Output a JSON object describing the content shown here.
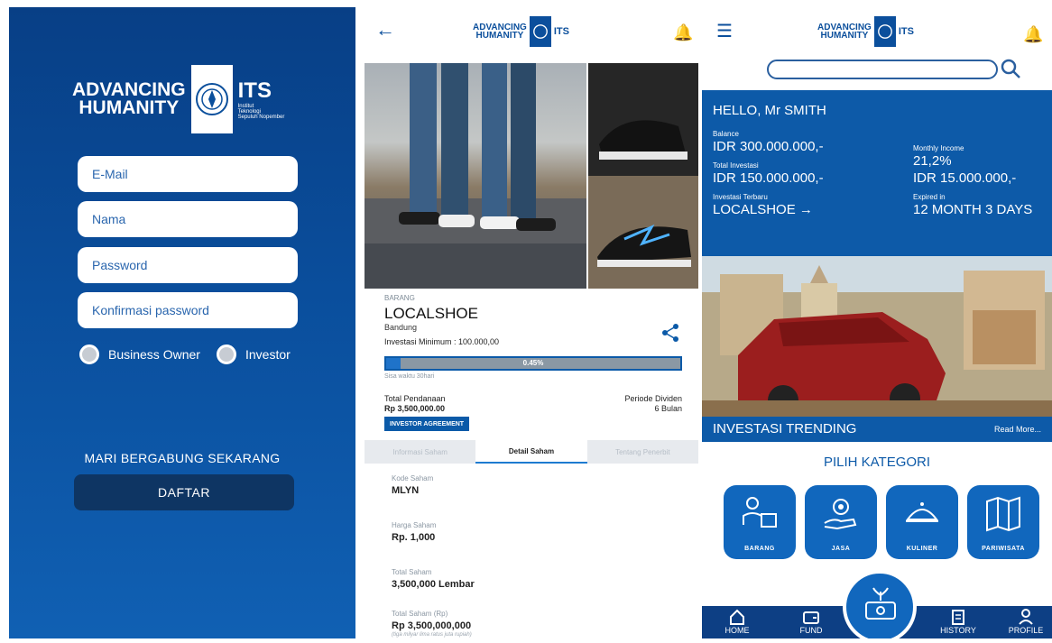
{
  "brand": {
    "line1": "ADVANCING",
    "line2": "HUMANITY",
    "its": "ITS",
    "its_sub1": "Institut",
    "its_sub2": "Teknologi",
    "its_sub3": "Sepuluh Nopember"
  },
  "register": {
    "email_placeholder": "E-Mail",
    "name_placeholder": "Nama",
    "password_placeholder": "Password",
    "confirm_placeholder": "Konfirmasi password",
    "role_business": "Business Owner",
    "role_investor": "Investor",
    "join_text": "MARI BERGABUNG SEKARANG",
    "submit_label": "DAFTAR"
  },
  "detail": {
    "category": "BARANG",
    "title": "LOCALSHOE",
    "city": "Bandung",
    "min_investment": "Investasi Minimum : 100.000,00",
    "progress_label": "0.45%",
    "progress_fraction": 0.0045,
    "remaining": "Sisa waktu 30hari",
    "total_funding_label": "Total Pendanaan",
    "total_funding_value": "Rp 3,500,000.00",
    "dividend_label": "Periode Dividen",
    "dividend_value": "6 Bulan",
    "agreement_label": "INVESTOR AGREEMENT",
    "tabs": [
      "Informasi Saham",
      "Detail Saham",
      "Tentang Penerbit"
    ],
    "stock_code_label": "Kode Saham",
    "stock_code_value": "MLYN",
    "stock_price_label": "Harga Saham",
    "stock_price_value": "Rp. 1,000",
    "total_shares_label": "Total Saham",
    "total_shares_value": "3,500,000 Lembar",
    "total_value_label": "Total Saham (Rp)",
    "total_value_value": "Rp 3,500,000,000",
    "total_value_note": "(tiga milyar lima ratus juta rupiah)"
  },
  "home": {
    "greeting": "HELLO, Mr SMITH",
    "balance_label": "Balance",
    "balance_value": "IDR 300.000.000,-",
    "total_invest_label": "Total Investasi",
    "total_invest_value": "IDR 150.000.000,-",
    "latest_label": "Investasi Terbaru",
    "latest_value": "LOCALSHOE →",
    "monthly_label": "Monthly Income",
    "monthly_pct": "21,2%",
    "monthly_value": "IDR 15.000.000,-",
    "expired_label": "Expired in",
    "expired_value": "12 MONTH 3 DAYS",
    "trending_title": "INVESTASI TRENDING",
    "read_more": "Read More...",
    "pilih": "PILIH KATEGORI",
    "categories": [
      "BARANG",
      "JASA",
      "KULINER",
      "PARIWISATA"
    ],
    "nav": [
      "HOME",
      "FUND",
      "HISTORY",
      "PROFILE"
    ]
  },
  "colors": {
    "primary": "#0d5aa8",
    "dark": "#0e3563",
    "nav": "#0d3f84"
  }
}
